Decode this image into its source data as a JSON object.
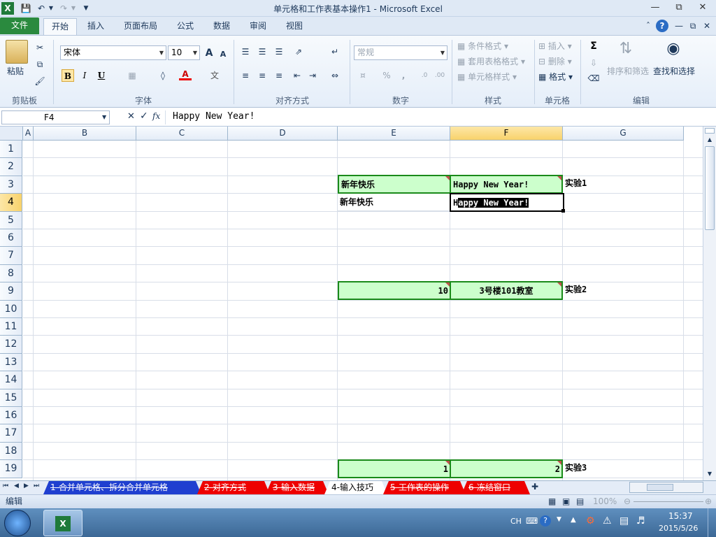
{
  "window": {
    "title": "单元格和工作表基本操作1 - Microsoft Excel"
  },
  "tabs": [
    {
      "label": "文件",
      "kind": "file"
    },
    {
      "label": "开始",
      "kind": "active"
    },
    {
      "label": "插入"
    },
    {
      "label": "页面布局"
    },
    {
      "label": "公式"
    },
    {
      "label": "数据"
    },
    {
      "label": "审阅"
    },
    {
      "label": "视图"
    }
  ],
  "ribbon": {
    "clipboard": {
      "paste": "粘贴",
      "group": "剪贴板"
    },
    "font": {
      "name": "宋体",
      "size": "10",
      "group": "字体",
      "bold": "B",
      "italic": "I",
      "underline": "U"
    },
    "alignment": {
      "group": "对齐方式"
    },
    "number": {
      "format": "常规",
      "percent": "%",
      "comma": ",",
      "group": "数字"
    },
    "styles": {
      "cond": "条件格式",
      "table": "套用表格格式",
      "cell": "单元格样式",
      "group": "样式"
    },
    "cells": {
      "insert": "插入",
      "delete": "删除",
      "format": "格式",
      "group": "单元格"
    },
    "editing": {
      "sum": "Σ",
      "sort": "排序和筛选",
      "find": "查找和选择",
      "group": "编辑"
    }
  },
  "formula_bar": {
    "name_box": "F4",
    "fx": "fx",
    "content": "Happy New Year!"
  },
  "columns": [
    "A",
    "B",
    "C",
    "D",
    "E",
    "F",
    "G"
  ],
  "rows": [
    "1",
    "2",
    "3",
    "4",
    "5",
    "6",
    "7",
    "8",
    "9",
    "10",
    "11",
    "12",
    "13",
    "14",
    "15",
    "16",
    "17",
    "18",
    "19"
  ],
  "selected": {
    "column": "F",
    "row": "4"
  },
  "cells": {
    "E3": "新年快乐",
    "F3": "Happy New Year!",
    "G3": "实验1",
    "E4": "新年快乐",
    "F4_first": "H",
    "F4_rest": "appy New Year!",
    "E9": "10",
    "F9": "3号楼101教室",
    "G9": "实验2",
    "E19": "1",
    "F19": "2",
    "G19": "实验3"
  },
  "sheet_tabs": [
    {
      "label": "1-合并单元格、拆分合并单元格",
      "active": false
    },
    {
      "label": "2-对齐方式",
      "active": false
    },
    {
      "label": "3-输入数据",
      "active": false
    },
    {
      "label": "4-输入技巧",
      "active": true
    },
    {
      "label": "5-工作表的操作",
      "active": false
    },
    {
      "label": "6-冻结窗口",
      "active": false
    }
  ],
  "status": {
    "mode": "编辑",
    "zoom": "100%"
  },
  "taskbar": {
    "lang": "CH",
    "time": "15:37",
    "date": "2015/5/26"
  },
  "colors": {
    "file_tab": "#2a8a3e",
    "cell_fill": "#ccffcc",
    "cell_border": "#1a8a1a",
    "tab_red": "#ee0000"
  }
}
